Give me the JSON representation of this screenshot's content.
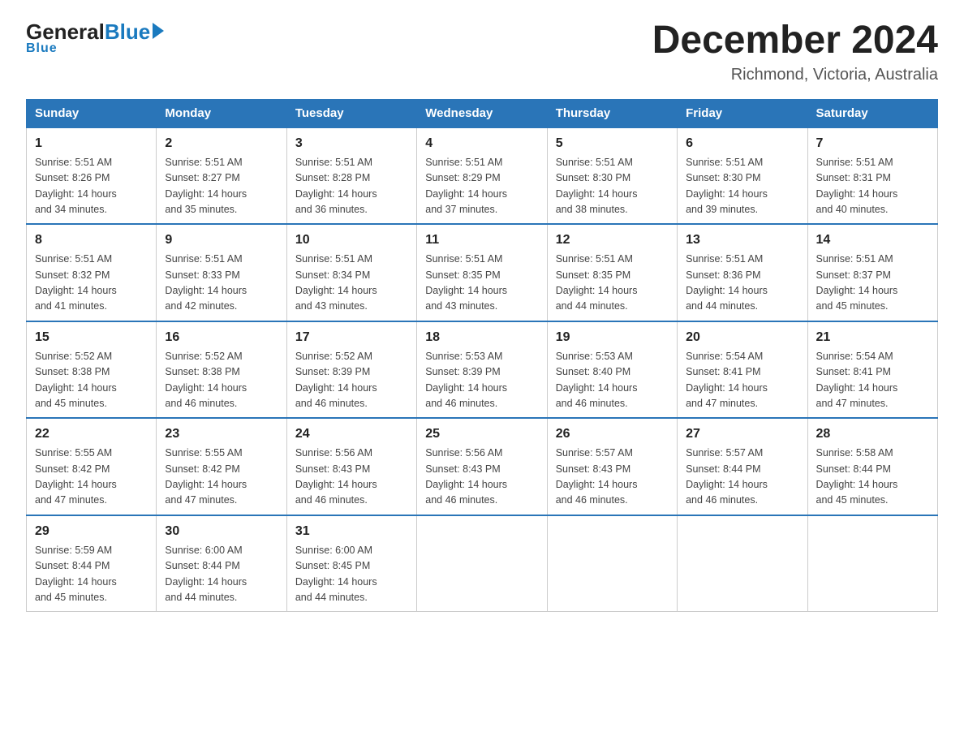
{
  "logo": {
    "general": "General",
    "blue": "Blue",
    "underline": "Blue"
  },
  "header": {
    "title": "December 2024",
    "subtitle": "Richmond, Victoria, Australia"
  },
  "days_of_week": [
    "Sunday",
    "Monday",
    "Tuesday",
    "Wednesday",
    "Thursday",
    "Friday",
    "Saturday"
  ],
  "weeks": [
    [
      {
        "day": "1",
        "sunrise": "5:51 AM",
        "sunset": "8:26 PM",
        "daylight": "14 hours and 34 minutes."
      },
      {
        "day": "2",
        "sunrise": "5:51 AM",
        "sunset": "8:27 PM",
        "daylight": "14 hours and 35 minutes."
      },
      {
        "day": "3",
        "sunrise": "5:51 AM",
        "sunset": "8:28 PM",
        "daylight": "14 hours and 36 minutes."
      },
      {
        "day": "4",
        "sunrise": "5:51 AM",
        "sunset": "8:29 PM",
        "daylight": "14 hours and 37 minutes."
      },
      {
        "day": "5",
        "sunrise": "5:51 AM",
        "sunset": "8:30 PM",
        "daylight": "14 hours and 38 minutes."
      },
      {
        "day": "6",
        "sunrise": "5:51 AM",
        "sunset": "8:30 PM",
        "daylight": "14 hours and 39 minutes."
      },
      {
        "day": "7",
        "sunrise": "5:51 AM",
        "sunset": "8:31 PM",
        "daylight": "14 hours and 40 minutes."
      }
    ],
    [
      {
        "day": "8",
        "sunrise": "5:51 AM",
        "sunset": "8:32 PM",
        "daylight": "14 hours and 41 minutes."
      },
      {
        "day": "9",
        "sunrise": "5:51 AM",
        "sunset": "8:33 PM",
        "daylight": "14 hours and 42 minutes."
      },
      {
        "day": "10",
        "sunrise": "5:51 AM",
        "sunset": "8:34 PM",
        "daylight": "14 hours and 43 minutes."
      },
      {
        "day": "11",
        "sunrise": "5:51 AM",
        "sunset": "8:35 PM",
        "daylight": "14 hours and 43 minutes."
      },
      {
        "day": "12",
        "sunrise": "5:51 AM",
        "sunset": "8:35 PM",
        "daylight": "14 hours and 44 minutes."
      },
      {
        "day": "13",
        "sunrise": "5:51 AM",
        "sunset": "8:36 PM",
        "daylight": "14 hours and 44 minutes."
      },
      {
        "day": "14",
        "sunrise": "5:51 AM",
        "sunset": "8:37 PM",
        "daylight": "14 hours and 45 minutes."
      }
    ],
    [
      {
        "day": "15",
        "sunrise": "5:52 AM",
        "sunset": "8:38 PM",
        "daylight": "14 hours and 45 minutes."
      },
      {
        "day": "16",
        "sunrise": "5:52 AM",
        "sunset": "8:38 PM",
        "daylight": "14 hours and 46 minutes."
      },
      {
        "day": "17",
        "sunrise": "5:52 AM",
        "sunset": "8:39 PM",
        "daylight": "14 hours and 46 minutes."
      },
      {
        "day": "18",
        "sunrise": "5:53 AM",
        "sunset": "8:39 PM",
        "daylight": "14 hours and 46 minutes."
      },
      {
        "day": "19",
        "sunrise": "5:53 AM",
        "sunset": "8:40 PM",
        "daylight": "14 hours and 46 minutes."
      },
      {
        "day": "20",
        "sunrise": "5:54 AM",
        "sunset": "8:41 PM",
        "daylight": "14 hours and 47 minutes."
      },
      {
        "day": "21",
        "sunrise": "5:54 AM",
        "sunset": "8:41 PM",
        "daylight": "14 hours and 47 minutes."
      }
    ],
    [
      {
        "day": "22",
        "sunrise": "5:55 AM",
        "sunset": "8:42 PM",
        "daylight": "14 hours and 47 minutes."
      },
      {
        "day": "23",
        "sunrise": "5:55 AM",
        "sunset": "8:42 PM",
        "daylight": "14 hours and 47 minutes."
      },
      {
        "day": "24",
        "sunrise": "5:56 AM",
        "sunset": "8:43 PM",
        "daylight": "14 hours and 46 minutes."
      },
      {
        "day": "25",
        "sunrise": "5:56 AM",
        "sunset": "8:43 PM",
        "daylight": "14 hours and 46 minutes."
      },
      {
        "day": "26",
        "sunrise": "5:57 AM",
        "sunset": "8:43 PM",
        "daylight": "14 hours and 46 minutes."
      },
      {
        "day": "27",
        "sunrise": "5:57 AM",
        "sunset": "8:44 PM",
        "daylight": "14 hours and 46 minutes."
      },
      {
        "day": "28",
        "sunrise": "5:58 AM",
        "sunset": "8:44 PM",
        "daylight": "14 hours and 45 minutes."
      }
    ],
    [
      {
        "day": "29",
        "sunrise": "5:59 AM",
        "sunset": "8:44 PM",
        "daylight": "14 hours and 45 minutes."
      },
      {
        "day": "30",
        "sunrise": "6:00 AM",
        "sunset": "8:44 PM",
        "daylight": "14 hours and 44 minutes."
      },
      {
        "day": "31",
        "sunrise": "6:00 AM",
        "sunset": "8:45 PM",
        "daylight": "14 hours and 44 minutes."
      },
      null,
      null,
      null,
      null
    ]
  ],
  "labels": {
    "sunrise": "Sunrise:",
    "sunset": "Sunset:",
    "daylight": "Daylight:"
  }
}
